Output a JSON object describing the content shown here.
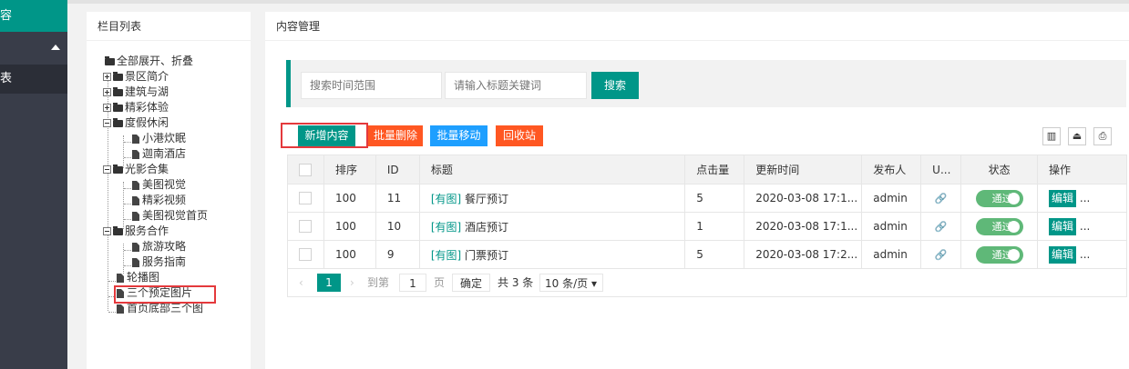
{
  "leftnav": {
    "active_label": "容",
    "item_label": "表"
  },
  "tree_panel": {
    "title": "栏目列表",
    "nodes": [
      "全部展开、折叠",
      "景区简介",
      "建筑与湖",
      "精彩体验",
      "度假休闲",
      "小港炊眠",
      "迦南酒店",
      "光影合集",
      "美图视觉",
      "精彩视频",
      "美图视觉首页",
      "服务合作",
      "旅游攻略",
      "服务指南",
      "轮播图",
      "三个预定图片",
      "首页底部三个图"
    ]
  },
  "content_panel": {
    "title": "内容管理"
  },
  "search": {
    "time_placeholder": "搜索时间范围",
    "keyword_placeholder": "请输入标题关键词",
    "search_label": "搜索"
  },
  "toolbar": {
    "add_label": "新增内容",
    "batch_delete_label": "批量删除",
    "batch_move_label": "批量移动",
    "recycle_label": "回收站"
  },
  "table": {
    "headers": [
      "排序",
      "ID",
      "标题",
      "点击量",
      "更新时间",
      "发布人",
      "U...",
      "状态",
      "操作"
    ],
    "rows": [
      {
        "sort": "100",
        "id": "11",
        "tag": "[有图]",
        "title": "餐厅预订",
        "clicks": "5",
        "updated": "2020-03-08 17:1...",
        "author": "admin",
        "status": "通过",
        "edit": "编辑",
        "more": "..."
      },
      {
        "sort": "100",
        "id": "10",
        "tag": "[有图]",
        "title": "酒店预订",
        "clicks": "1",
        "updated": "2020-03-08 17:1...",
        "author": "admin",
        "status": "通过",
        "edit": "编辑",
        "more": "..."
      },
      {
        "sort": "100",
        "id": "9",
        "tag": "[有图]",
        "title": "门票预订",
        "clicks": "5",
        "updated": "2020-03-08 17:2...",
        "author": "admin",
        "status": "通过",
        "edit": "编辑",
        "more": "..."
      }
    ]
  },
  "pager": {
    "current": "1",
    "goto_prefix": "到第",
    "goto_value": "1",
    "page_suffix": "页",
    "confirm": "确定",
    "total": "共 3 条",
    "per_page": "10 条/页"
  },
  "colors": {
    "primary": "#009688",
    "danger": "#ff5722",
    "info": "#1e9fff",
    "switch_on": "#5fb878",
    "highlight": "#e4393c"
  }
}
